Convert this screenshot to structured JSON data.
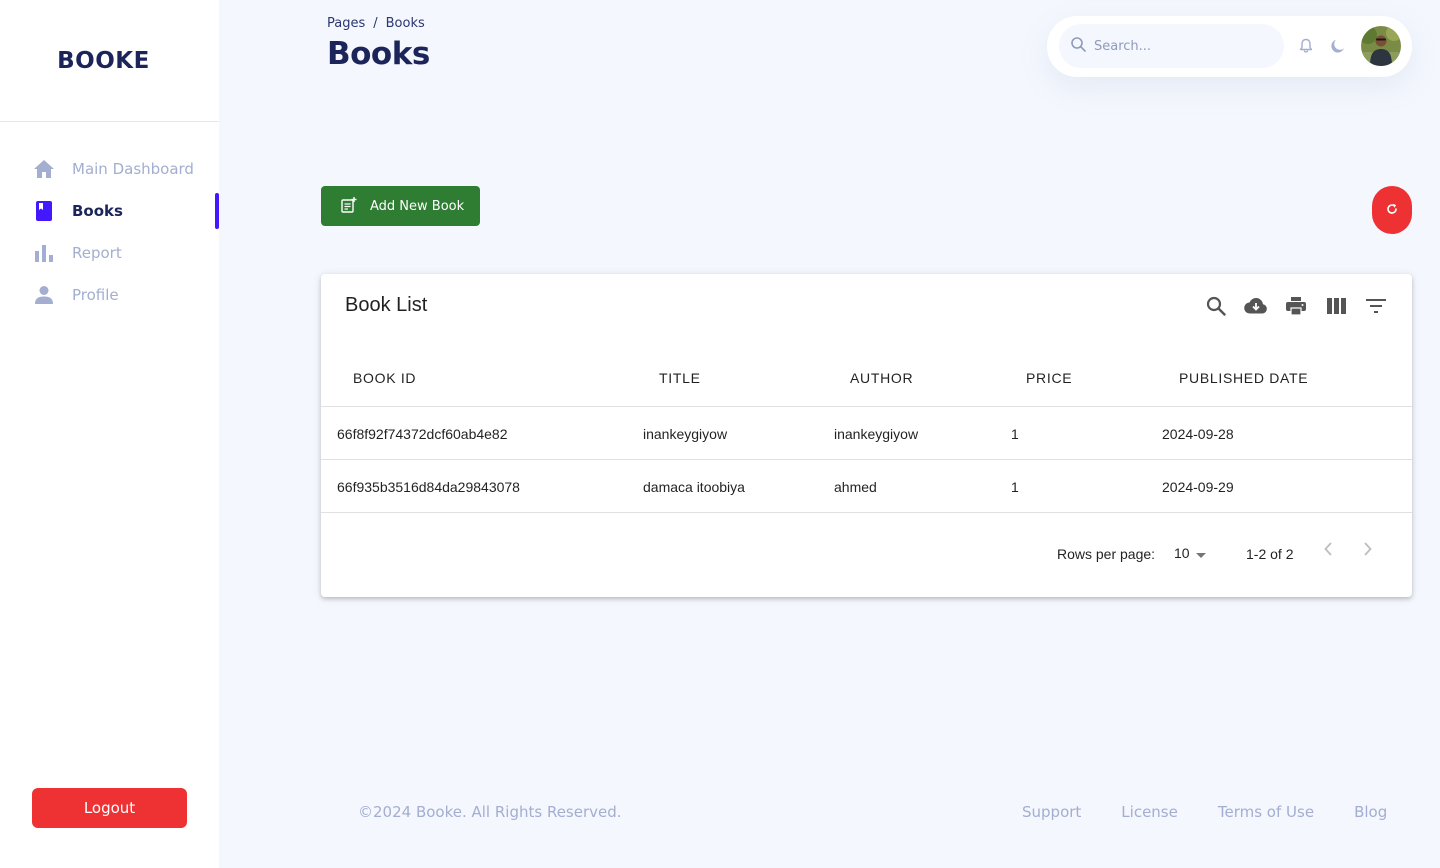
{
  "brand": {
    "name": "BOOKE"
  },
  "sidebar": {
    "items": [
      {
        "label": "Main Dashboard",
        "icon": "home-icon",
        "active": false
      },
      {
        "label": "Books",
        "icon": "book-icon",
        "active": true
      },
      {
        "label": "Report",
        "icon": "bar-chart-icon",
        "active": false
      },
      {
        "label": "Profile",
        "icon": "person-icon",
        "active": false
      }
    ],
    "logout_label": "Logout"
  },
  "header": {
    "breadcrumb": [
      "Pages",
      "Books"
    ],
    "separator": "/",
    "title": "Books",
    "search_placeholder": "Search..."
  },
  "actions": {
    "add_label": "Add New Book"
  },
  "table": {
    "title": "Book List",
    "columns": [
      "BOOK ID",
      "TITLE",
      "AUTHOR",
      "PRICE",
      "PUBLISHED DATE"
    ],
    "rows": [
      [
        "66f8f92f74372dcf60ab4e82",
        "inankeygiyow",
        "inankeygiyow",
        "1",
        "2024-09-28"
      ],
      [
        "66f935b3516d84da29843078",
        "damaca itoobiya",
        "ahmed",
        "1",
        "2024-09-29"
      ]
    ],
    "pagination": {
      "rows_per_page_label": "Rows per page:",
      "rows_per_page": "10",
      "range": "1-2 of 2"
    }
  },
  "footer": {
    "copyright": "©2024 Booke. All Rights Reserved.",
    "links": [
      "Support",
      "License",
      "Terms of Use",
      "Blog"
    ]
  },
  "colors": {
    "navy": "#1B2559",
    "muted": "#A3AED0",
    "accent": "#4318FF",
    "green": "#2E7D32",
    "red": "#EE3234",
    "background": "#F4F7FE"
  }
}
